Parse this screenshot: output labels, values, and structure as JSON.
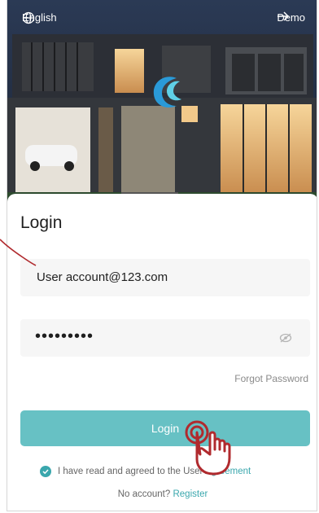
{
  "topbar": {
    "language": "English",
    "demo_label": "Demo"
  },
  "login": {
    "title": "Login",
    "account_value": "User account@123.com",
    "password_masked": "•••••••••",
    "forgot_label": "Forgot Password",
    "button_label": "Login"
  },
  "agreement": {
    "text_before": "I have read and agreed to the ",
    "text_hidden": "User",
    "link_text": "Agreement"
  },
  "register": {
    "prompt": "No account? ",
    "link_text": "Register"
  },
  "icons": {
    "language": "globe-icon",
    "demo": "arrow-right-icon",
    "password_visibility": "eye-off-icon",
    "agreement_check": "check-circle-icon",
    "logo": "logo-icon",
    "pointer": "hand-pointer-icon"
  },
  "colors": {
    "accent": "#67c1c4",
    "link": "#3aa7ad",
    "annotation": "#b02a2e"
  }
}
